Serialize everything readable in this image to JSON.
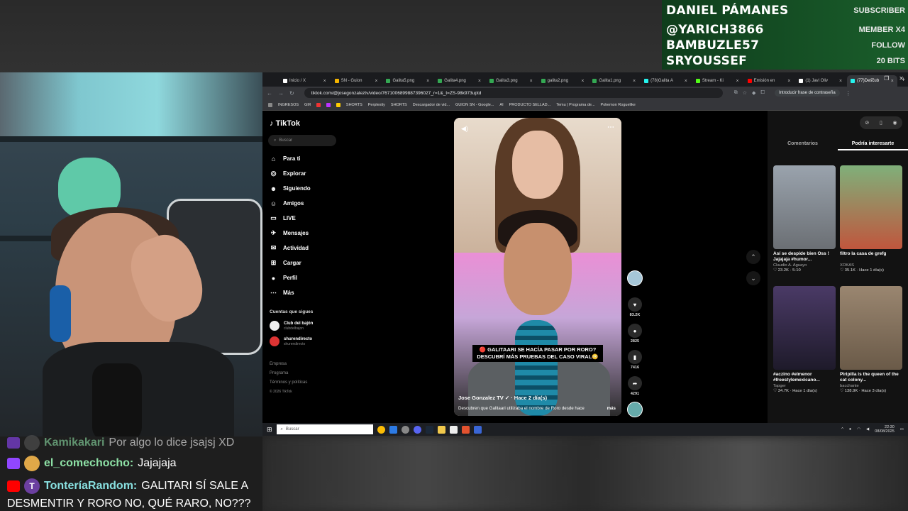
{
  "events": [
    {
      "name": "DANIEL PÁMANES",
      "tag": "SUBSCRIBER"
    },
    {
      "name": "@YARICH3866",
      "tag": "MEMBER X4"
    },
    {
      "name": "BAMBUZLE57",
      "tag": "FOLLOW"
    },
    {
      "name": "SRYOUSSEF",
      "tag": "20 BITS"
    }
  ],
  "chat": [
    {
      "platform": "twitch",
      "avatar": "",
      "user": "Kamikakari",
      "msg": "Por algo lo dice jsajsj XD",
      "color": "green"
    },
    {
      "platform": "twitch",
      "avatar": "",
      "user": "el_comechocho:",
      "msg": "Jajajaja",
      "color": "green"
    },
    {
      "platform": "youtube",
      "avatar": "T",
      "user": "TonteríaRandom:",
      "msg": "GALITARI SÍ SALE A",
      "color": "teal"
    }
  ],
  "chat_cont": "DESMENTIR Y RORO NO, QUÉ RARO, NO???",
  "browser": {
    "tabs": [
      {
        "label": "Inicio / X",
        "color": "#000000"
      },
      {
        "label": "SN - Guion",
        "color": "#f4b400"
      },
      {
        "label": "Galita5.png",
        "color": "#34a853"
      },
      {
        "label": "Galita4.png",
        "color": "#34a853"
      },
      {
        "label": "Galita3.png",
        "color": "#34a853"
      },
      {
        "label": "galita2.png",
        "color": "#34a853"
      },
      {
        "label": "Galita1.png",
        "color": "#34a853"
      },
      {
        "label": "(78)Galita A",
        "color": "#111111"
      },
      {
        "label": "Stream - Ki",
        "color": "#53fc18"
      },
      {
        "label": "Emisión en",
        "color": "#ff0000"
      },
      {
        "label": "(1) Javi Oliv",
        "color": "#000000"
      },
      {
        "label": "(77)Descub",
        "color": "#111111"
      }
    ],
    "url": "tiktok.com/@josegonzaleztv/video/7671006899887396027_r=1&_t=ZS-98k973uptd",
    "password_hint": "Introducir frase de contraseña",
    "bookmarks": [
      "INGRESOS",
      "GM",
      "SHORTS",
      "Perplexity",
      "SHORTS",
      "Descargador de vid...",
      "GUION SN - Google...",
      "AI",
      "PRODUCTO SELLAD...",
      "Temu | Programa de...",
      "Pokemon Roguelike"
    ]
  },
  "tiktok": {
    "logo": "TikTok",
    "search_placeholder": "Buscar",
    "nav": [
      "Para ti",
      "Explorar",
      "Siguiendo",
      "Amigos",
      "LIVE",
      "Mensajes",
      "Actividad",
      "Cargar",
      "Perfil",
      "Más"
    ],
    "following_title": "Cuentas que sigues",
    "following": [
      {
        "name": "Club del bajón",
        "handle": "clubdelbajon"
      },
      {
        "name": "shurendirecto",
        "handle": "shurendirecto"
      }
    ],
    "footer": [
      "Empresa",
      "Programa",
      "Términos y políticas",
      "© 2026 TikTok"
    ],
    "video": {
      "caption": "🔴 GALITAARI SE HACÍA PASAR POR RORO? DESCUBRÍ MÁS PRUEBAS DEL CASO VIRAL😳",
      "author": "Jose Gonzalez TV ✓ · Hace 2 día(s)",
      "desc": "Descubren que Galitaari utilizaba el nombre de Roro desde hace",
      "more": "más"
    },
    "actions": {
      "likes": "83.2K",
      "comments": "2825",
      "saves": "7416",
      "shares": "4291"
    },
    "panel_tabs": [
      "Comentarios",
      "Podría interesarte"
    ],
    "cards": [
      {
        "title": "Así se despide bien Oss ! Jajajaja #humor...",
        "author": "Claudio A. Aguayo",
        "meta": "♡ 23.2K · 5-10",
        "color": "#8a8f96"
      },
      {
        "title": "filtro la casa de grefg",
        "author": "XOKAS",
        "meta": "♡ 35.1K · Hace 1 día(s)",
        "color": "#c0563d"
      },
      {
        "title": "#aczino #elmenor #freestylemexicano...",
        "author": "Tapger",
        "meta": "♡ 34.7K · Hace 1 día(s)",
        "color": "#3a2c4f"
      },
      {
        "title": "Piripilla is the queen of the cat colony...",
        "author": "bacchante",
        "meta": "♡ 138.9K · Hace 3 día(s)",
        "color": "#7a6a58"
      }
    ]
  },
  "taskbar": {
    "search": "Buscar",
    "time": "22:30",
    "date": "08/08/2025"
  }
}
